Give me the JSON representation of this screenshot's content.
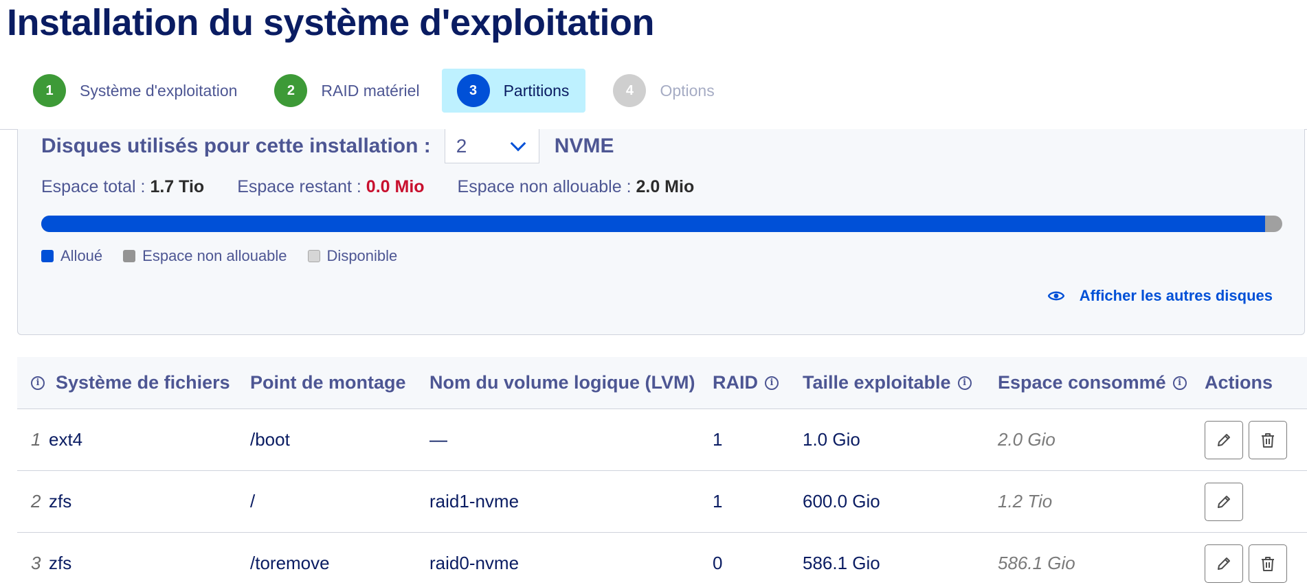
{
  "page": {
    "title": "Installation du système d'exploitation"
  },
  "steps": [
    {
      "number": "1",
      "label": "Système d'exploitation",
      "state": "done"
    },
    {
      "number": "2",
      "label": "RAID matériel",
      "state": "done"
    },
    {
      "number": "3",
      "label": "Partitions",
      "state": "active"
    },
    {
      "number": "4",
      "label": "Options",
      "state": "todo"
    }
  ],
  "disks": {
    "question": "Disques utilisés pour cette installation :",
    "count": "2",
    "type": "NVME",
    "total_label": "Espace total :",
    "total_value": "1.7 Tio",
    "remaining_label": "Espace restant :",
    "remaining_value": "0.0 Mio",
    "unallocatable_label": "Espace non allouable :",
    "unallocatable_value": "2.0 Mio",
    "allocated_fraction": 0.986,
    "legend": {
      "allocated": "Alloué",
      "unallocatable": "Espace non allouable",
      "available": "Disponible"
    },
    "show_other_disks": "Afficher les autres disques"
  },
  "colors": {
    "allocated": "#0050d7",
    "unallocatable": "#949494",
    "available": "#d6d6d6",
    "remaining_alert": "#c8102e",
    "step_done": "#3d9a37",
    "step_active_bg": "#bef1ff"
  },
  "table": {
    "headers": {
      "filesystem": "Système de fichiers",
      "mountpoint": "Point de montage",
      "lvm": "Nom du volume logique (LVM)",
      "raid": "RAID",
      "size": "Taille exploitable",
      "consumed": "Espace consommé",
      "actions": "Actions"
    },
    "rows": [
      {
        "index": "1",
        "filesystem": "ext4",
        "mountpoint": "/boot",
        "lvm": "—",
        "raid": "1",
        "size": "1.0 Gio",
        "consumed": "2.0 Gio",
        "deletable": true
      },
      {
        "index": "2",
        "filesystem": "zfs",
        "mountpoint": "/",
        "lvm": "raid1-nvme",
        "raid": "1",
        "size": "600.0 Gio",
        "consumed": "1.2 Tio",
        "deletable": false
      },
      {
        "index": "3",
        "filesystem": "zfs",
        "mountpoint": "/toremove",
        "lvm": "raid0-nvme",
        "raid": "0",
        "size": "586.1 Gio",
        "consumed": "586.1 Gio",
        "deletable": true
      }
    ]
  },
  "icons": {
    "info": "info-icon",
    "eye": "eye-icon",
    "edit": "pencil-icon",
    "delete": "trash-icon",
    "dropdown": "chevron-down-icon"
  }
}
